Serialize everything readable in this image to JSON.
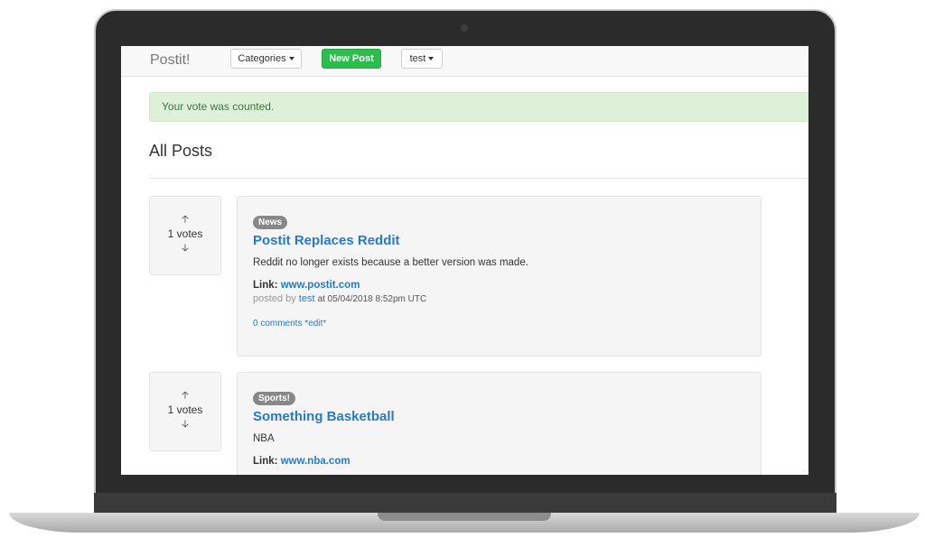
{
  "navbar": {
    "brand": "Postit!",
    "categories_label": "Categories",
    "new_post_label": "New Post",
    "user_label": "test"
  },
  "alert": {
    "message": "Your vote was counted."
  },
  "page": {
    "title": "All Posts"
  },
  "posts": [
    {
      "category": "News",
      "title": "Postit Replaces Reddit",
      "body": "Reddit no longer exists because a better version was made.",
      "link_label": "Link:",
      "link": "www.postit.com",
      "posted_by_label": "posted by",
      "author": "test",
      "date": "at 05/04/2018 8:52pm UTC",
      "comments": "0 comments",
      "edit": "*edit*",
      "votes": "1 votes",
      "up_icon": "arrow-up-icon",
      "down_icon": "arrow-down-icon"
    },
    {
      "category": "Sports!",
      "title": "Something Basketball",
      "body": "NBA",
      "link_label": "Link:",
      "link": "www.nba.com",
      "votes": "1 votes",
      "up_icon": "arrow-up-icon",
      "down_icon": "arrow-down-icon"
    }
  ],
  "colors": {
    "link": "#2a7ac0",
    "success": "#2dbd4f",
    "alert_bg": "#dff0d8",
    "alert_text": "#3c763d"
  }
}
